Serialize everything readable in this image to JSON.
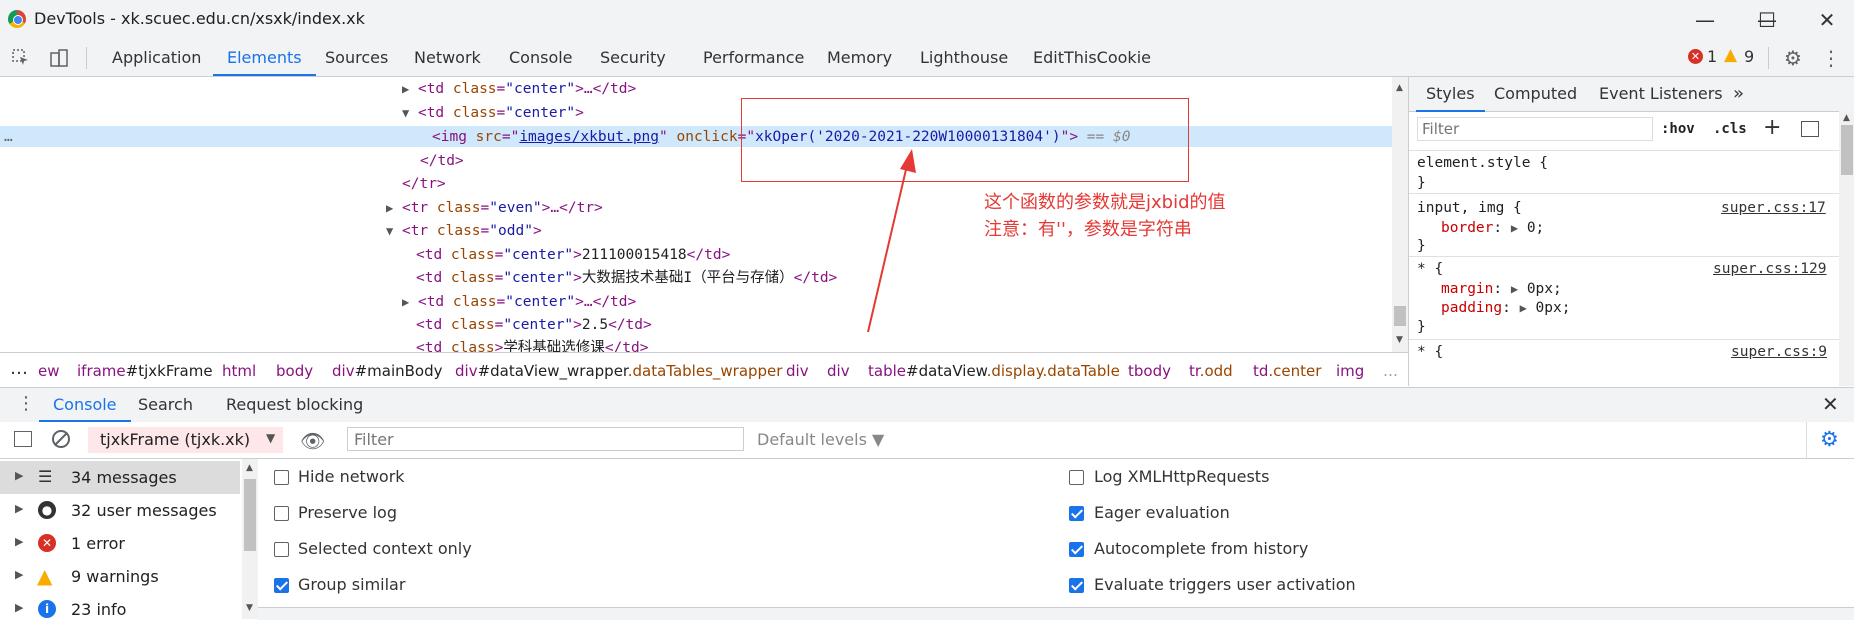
{
  "window": {
    "title": "DevTools - xk.scuec.edu.cn/xsxk/index.xk",
    "minimize": "—",
    "maximize": "☐",
    "close": "✕"
  },
  "toolbar": {
    "tabs": [
      "Application",
      "Elements",
      "Sources",
      "Network",
      "Console",
      "Security",
      "Performance",
      "Memory",
      "Lighthouse",
      "EditThisCookie"
    ],
    "active_tab": "Elements",
    "error_count": "1",
    "warning_count": "9"
  },
  "elements": {
    "line1_tag": "<td ",
    "line1_attr": "class",
    "line1_val": "\"center\"",
    "line1_rest": ">…</td>",
    "line2_tag": "<td ",
    "line2_attr": "class",
    "line2_val": "\"center\"",
    "line2_rest": ">",
    "line3_tag": "<img ",
    "line3_attr1": "src",
    "line3_val1": "images/xkbut.png",
    "line3_attr2": "onclick",
    "line3_val2": "xkOper('2020-2021-220W10000131804')",
    "line3_close": ">",
    "line3_eq": " == $0",
    "line4": "</td>",
    "line5": "</tr>",
    "line6_tag": "<tr ",
    "line6_attr": "class",
    "line6_val": "\"even\"",
    "line6_rest": ">…</tr>",
    "line7_tag": "<tr ",
    "line7_attr": "class",
    "line7_val": "\"odd\"",
    "line7_rest": ">",
    "line8_val": "\"center\"",
    "line8_text": "211100015418",
    "line9_val": "\"center\"",
    "line9_text": "大数据技术基础I（平台与存储）",
    "line10_val": "\"center\"",
    "line10_rest": ">…</td>",
    "line11_val": "\"center\"",
    "line11_text": "2.5",
    "line12_text": "学科基础选修课",
    "td_open": "<td ",
    "td_close": "</td>",
    "class": "class",
    "gt": ">",
    "row_dots": "…"
  },
  "annotation": {
    "line1": "这个函数的参数就是jxbid的值",
    "line2": "注意：有''，参数是字符串"
  },
  "breadcrumb": {
    "dots": "…",
    "items": [
      "ew",
      "iframe",
      "#tjxkFrame",
      "html",
      "body",
      "div",
      "#mainBody",
      "div",
      "#dataView_wrapper",
      ".dataTables_wrapper",
      "div",
      "div",
      "table",
      "#dataView",
      ".display.dataTable",
      "tbody",
      "tr",
      ".odd",
      "td",
      ".center",
      "img"
    ],
    "more": "…"
  },
  "styles": {
    "tabs": [
      "Styles",
      "Computed",
      "Event Listeners"
    ],
    "more": "»",
    "filter_placeholder": "Filter",
    "hov": ":hov",
    "cls": ".cls",
    "plus": "+",
    "rule1_selector": "element.style {",
    "rule_close": "}",
    "rule2_selector": "input, img {",
    "rule2_source": "super.css:17",
    "rule2_prop": "border",
    "rule2_value": "0;",
    "rule3_selector": "* {",
    "rule3_source": "super.css:129",
    "rule3_prop1": "margin",
    "rule3_value1": "0px;",
    "rule3_prop2": "padding",
    "rule3_value2": "0px;",
    "rule4_selector": "* {",
    "rule4_source": "super.css:9"
  },
  "console": {
    "tabs": [
      "Console",
      "Search",
      "Request blocking"
    ],
    "active_tab": "Console",
    "context": "tjxkFrame (tjxk.xk)",
    "filter_placeholder": "Filter",
    "levels": "Default levels ▼",
    "sidebar": [
      {
        "label": "34 messages"
      },
      {
        "label": "32 user messages"
      },
      {
        "label": "1 error"
      },
      {
        "label": "9 warnings"
      },
      {
        "label": "23 info"
      }
    ],
    "options_left": [
      {
        "label": "Hide network",
        "checked": false
      },
      {
        "label": "Preserve log",
        "checked": false
      },
      {
        "label": "Selected context only",
        "checked": false
      },
      {
        "label": "Group similar",
        "checked": true
      }
    ],
    "options_right": [
      {
        "label": "Log XMLHttpRequests",
        "checked": false
      },
      {
        "label": "Eager evaluation",
        "checked": true
      },
      {
        "label": "Autocomplete from history",
        "checked": true
      },
      {
        "label": "Evaluate triggers user activation",
        "checked": true
      }
    ]
  }
}
